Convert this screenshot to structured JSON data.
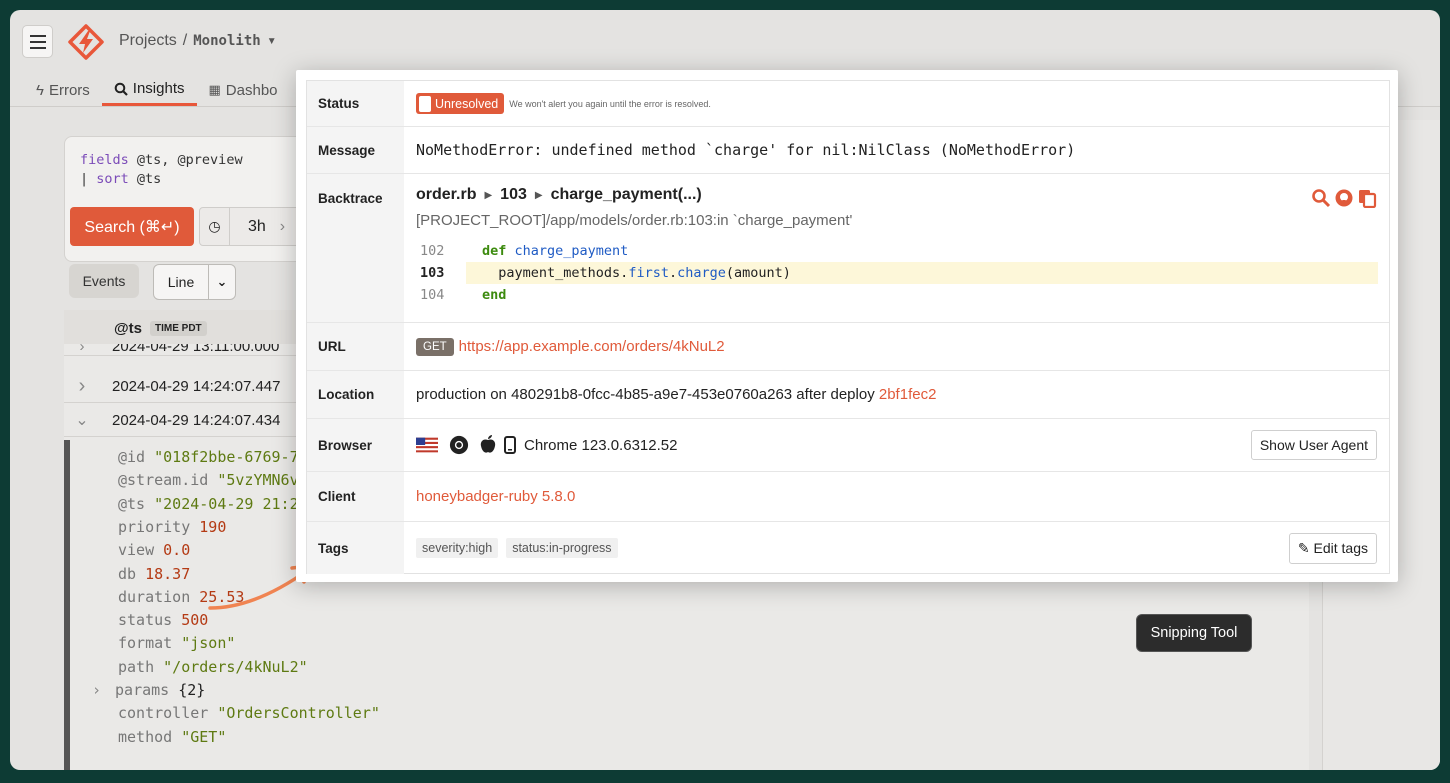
{
  "header": {
    "crumb_projects": "Projects",
    "crumb_sep": "/",
    "crumb_project": "Monolith",
    "brand_color": "#e8573a"
  },
  "tabs": [
    {
      "label": "Errors",
      "icon": "bolt-icon"
    },
    {
      "label": "Insights",
      "icon": "search-icon"
    },
    {
      "label": "Dashbo",
      "icon": "grid-icon"
    }
  ],
  "query": {
    "line1_kw": "fields",
    "line1_rest": " @ts, @preview",
    "line2_pipe": "| ",
    "line2_kw": "sort",
    "line2_rest": " @ts",
    "search_label": "Search (⌘↵)",
    "range": "3h"
  },
  "view": {
    "events_label": "Events",
    "line_label": "Line"
  },
  "results": {
    "col_header": "@ts",
    "col_badge": "TIME PDT",
    "rows": [
      "2024-04-29 13:11:00.000",
      "2024-04-29 14:24:07.447",
      "2024-04-29 14:24:07.434"
    ],
    "fields": [
      {
        "k": "@id",
        "v": "\"018f2bbe-6769-7",
        "t": "s"
      },
      {
        "k": "@stream.id",
        "v": "\"5vzYMN6v",
        "t": "s"
      },
      {
        "k": "@ts",
        "v": "\"2024-04-29 21:2",
        "t": "s"
      },
      {
        "k": "priority",
        "v": "190",
        "t": "n"
      },
      {
        "k": "view",
        "v": "0.0",
        "t": "n"
      },
      {
        "k": "db",
        "v": "18.37",
        "t": "n"
      },
      {
        "k": "duration",
        "v": "25.53",
        "t": "n"
      },
      {
        "k": "status",
        "v": "500",
        "t": "n"
      },
      {
        "k": "format",
        "v": "\"json\"",
        "t": "s"
      },
      {
        "k": "path",
        "v": "\"/orders/4kNuL2\"",
        "t": "s"
      },
      {
        "k": "params",
        "v": "{2}",
        "t": "p"
      },
      {
        "k": "controller",
        "v": "\"OrdersController\"",
        "t": "s"
      },
      {
        "k": "method",
        "v": "\"GET\"",
        "t": "s"
      }
    ]
  },
  "modal": {
    "status_label": "Status",
    "status_badge": "Unresolved",
    "status_note": "We won't alert you again until the error is resolved.",
    "message_label": "Message",
    "message": "NoMethodError: undefined method `charge' for nil:NilClass (NoMethodError)",
    "backtrace_label": "Backtrace",
    "bt_file": "order.rb",
    "bt_line": "103",
    "bt_method": "charge_payment(...)",
    "bt_path": "[PROJECT_ROOT]/app/models/order.rb:103:in `charge_payment'",
    "code": [
      {
        "ln": "102",
        "kw": "def ",
        "fn": "charge_payment",
        "rest": ""
      },
      {
        "ln": "103",
        "pre": "  payment_methods.",
        "fn": "first",
        "dot": ".",
        "fn2": "charge",
        "rest": "(amount)"
      },
      {
        "ln": "104",
        "kw": "end",
        "fn": "",
        "rest": ""
      }
    ],
    "url_label": "URL",
    "url_method": "GET",
    "url": "https://app.example.com/orders/4kNuL2",
    "location_label": "Location",
    "location_text": "production on 480291b8-0fcc-4b85-a9e7-453e0760a263 after deploy ",
    "location_deploy": "2bf1fec2",
    "browser_label": "Browser",
    "browser_text": "Chrome 123.0.6312.52",
    "browser_button": "Show User Agent",
    "client_label": "Client",
    "client": "honeybadger-ruby 5.8.0",
    "tags_label": "Tags",
    "tags": [
      "severity:high",
      "status:in-progress"
    ],
    "edit_tags": "Edit tags"
  },
  "tooltip": "Snipping Tool"
}
